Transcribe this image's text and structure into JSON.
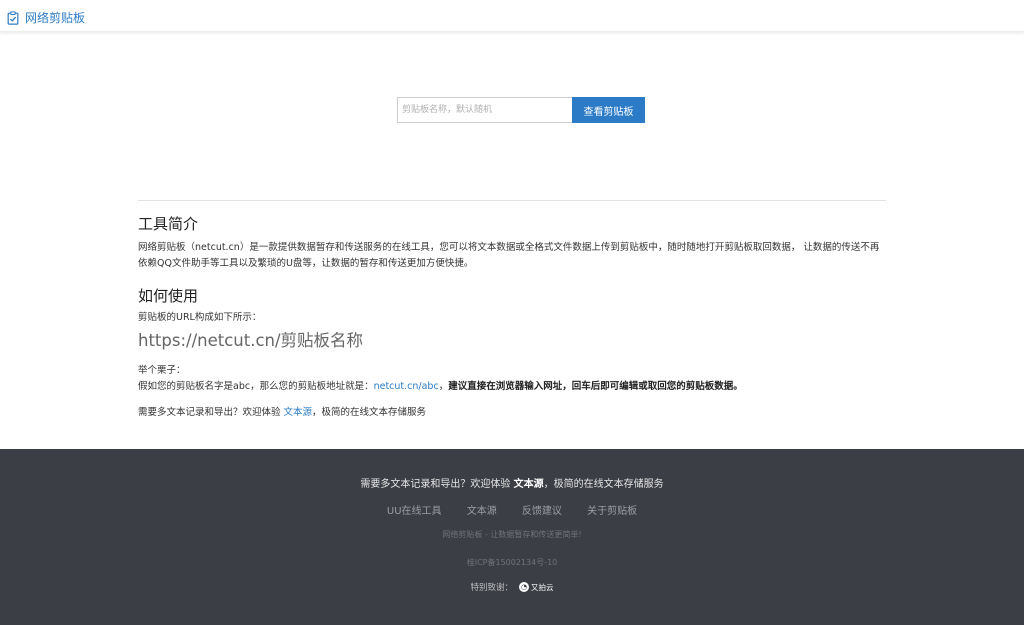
{
  "header": {
    "brand": "网络剪贴板",
    "brand_icon": "clipboard-check-icon",
    "accent": "#2e7cc4"
  },
  "search": {
    "placeholder": "剪贴板名称，默认随机",
    "button_label": "查看剪贴板"
  },
  "intro": {
    "title": "工具简介",
    "text": "网络剪贴板（netcut.cn）是一款提供数据暂存和传送服务的在线工具，您可以将文本数据或全格式文件数据上传到剪贴板中，随时随地打开剪贴板取回数据， 让数据的传送不再依赖QQ文件助手等工具以及繁琐的U盘等，让数据的暂存和传送更加方便快捷。"
  },
  "usage": {
    "title": "如何使用",
    "url_format_label": "剪贴板的URL构成如下所示：",
    "url_format": "https://netcut.cn/剪贴板名称",
    "example_label": "举个栗子：",
    "example_prefix": "假如您的剪贴板名字是abc，那么您的剪贴板地址就是：",
    "example_link": "netcut.cn/abc",
    "example_sep": "，",
    "example_tip": "建议直接在浏览器输入网址，回车后即可编辑或取回您的剪贴板数据。",
    "promo_prefix": "需要多文本记录和导出？欢迎体验 ",
    "promo_link": "文本源",
    "promo_suffix": "，极简的在线文本存储服务"
  },
  "footer": {
    "promo_prefix": "需要多文本记录和导出？欢迎体验 ",
    "promo_link": "文本源",
    "promo_suffix": "，极简的在线文本存储服务",
    "links": [
      "UU在线工具",
      "文本源",
      "反馈建议",
      "关于剪贴板"
    ],
    "slogan": "网络剪贴板 - 让数据暂存和传送更简单!",
    "icp": "桂ICP备15002134号-10",
    "thanks_label": "特别致谢：",
    "sponsor_name": "又拍云",
    "sponsor_icon": "upyun-logo-icon",
    "background": "#3b3e44"
  }
}
